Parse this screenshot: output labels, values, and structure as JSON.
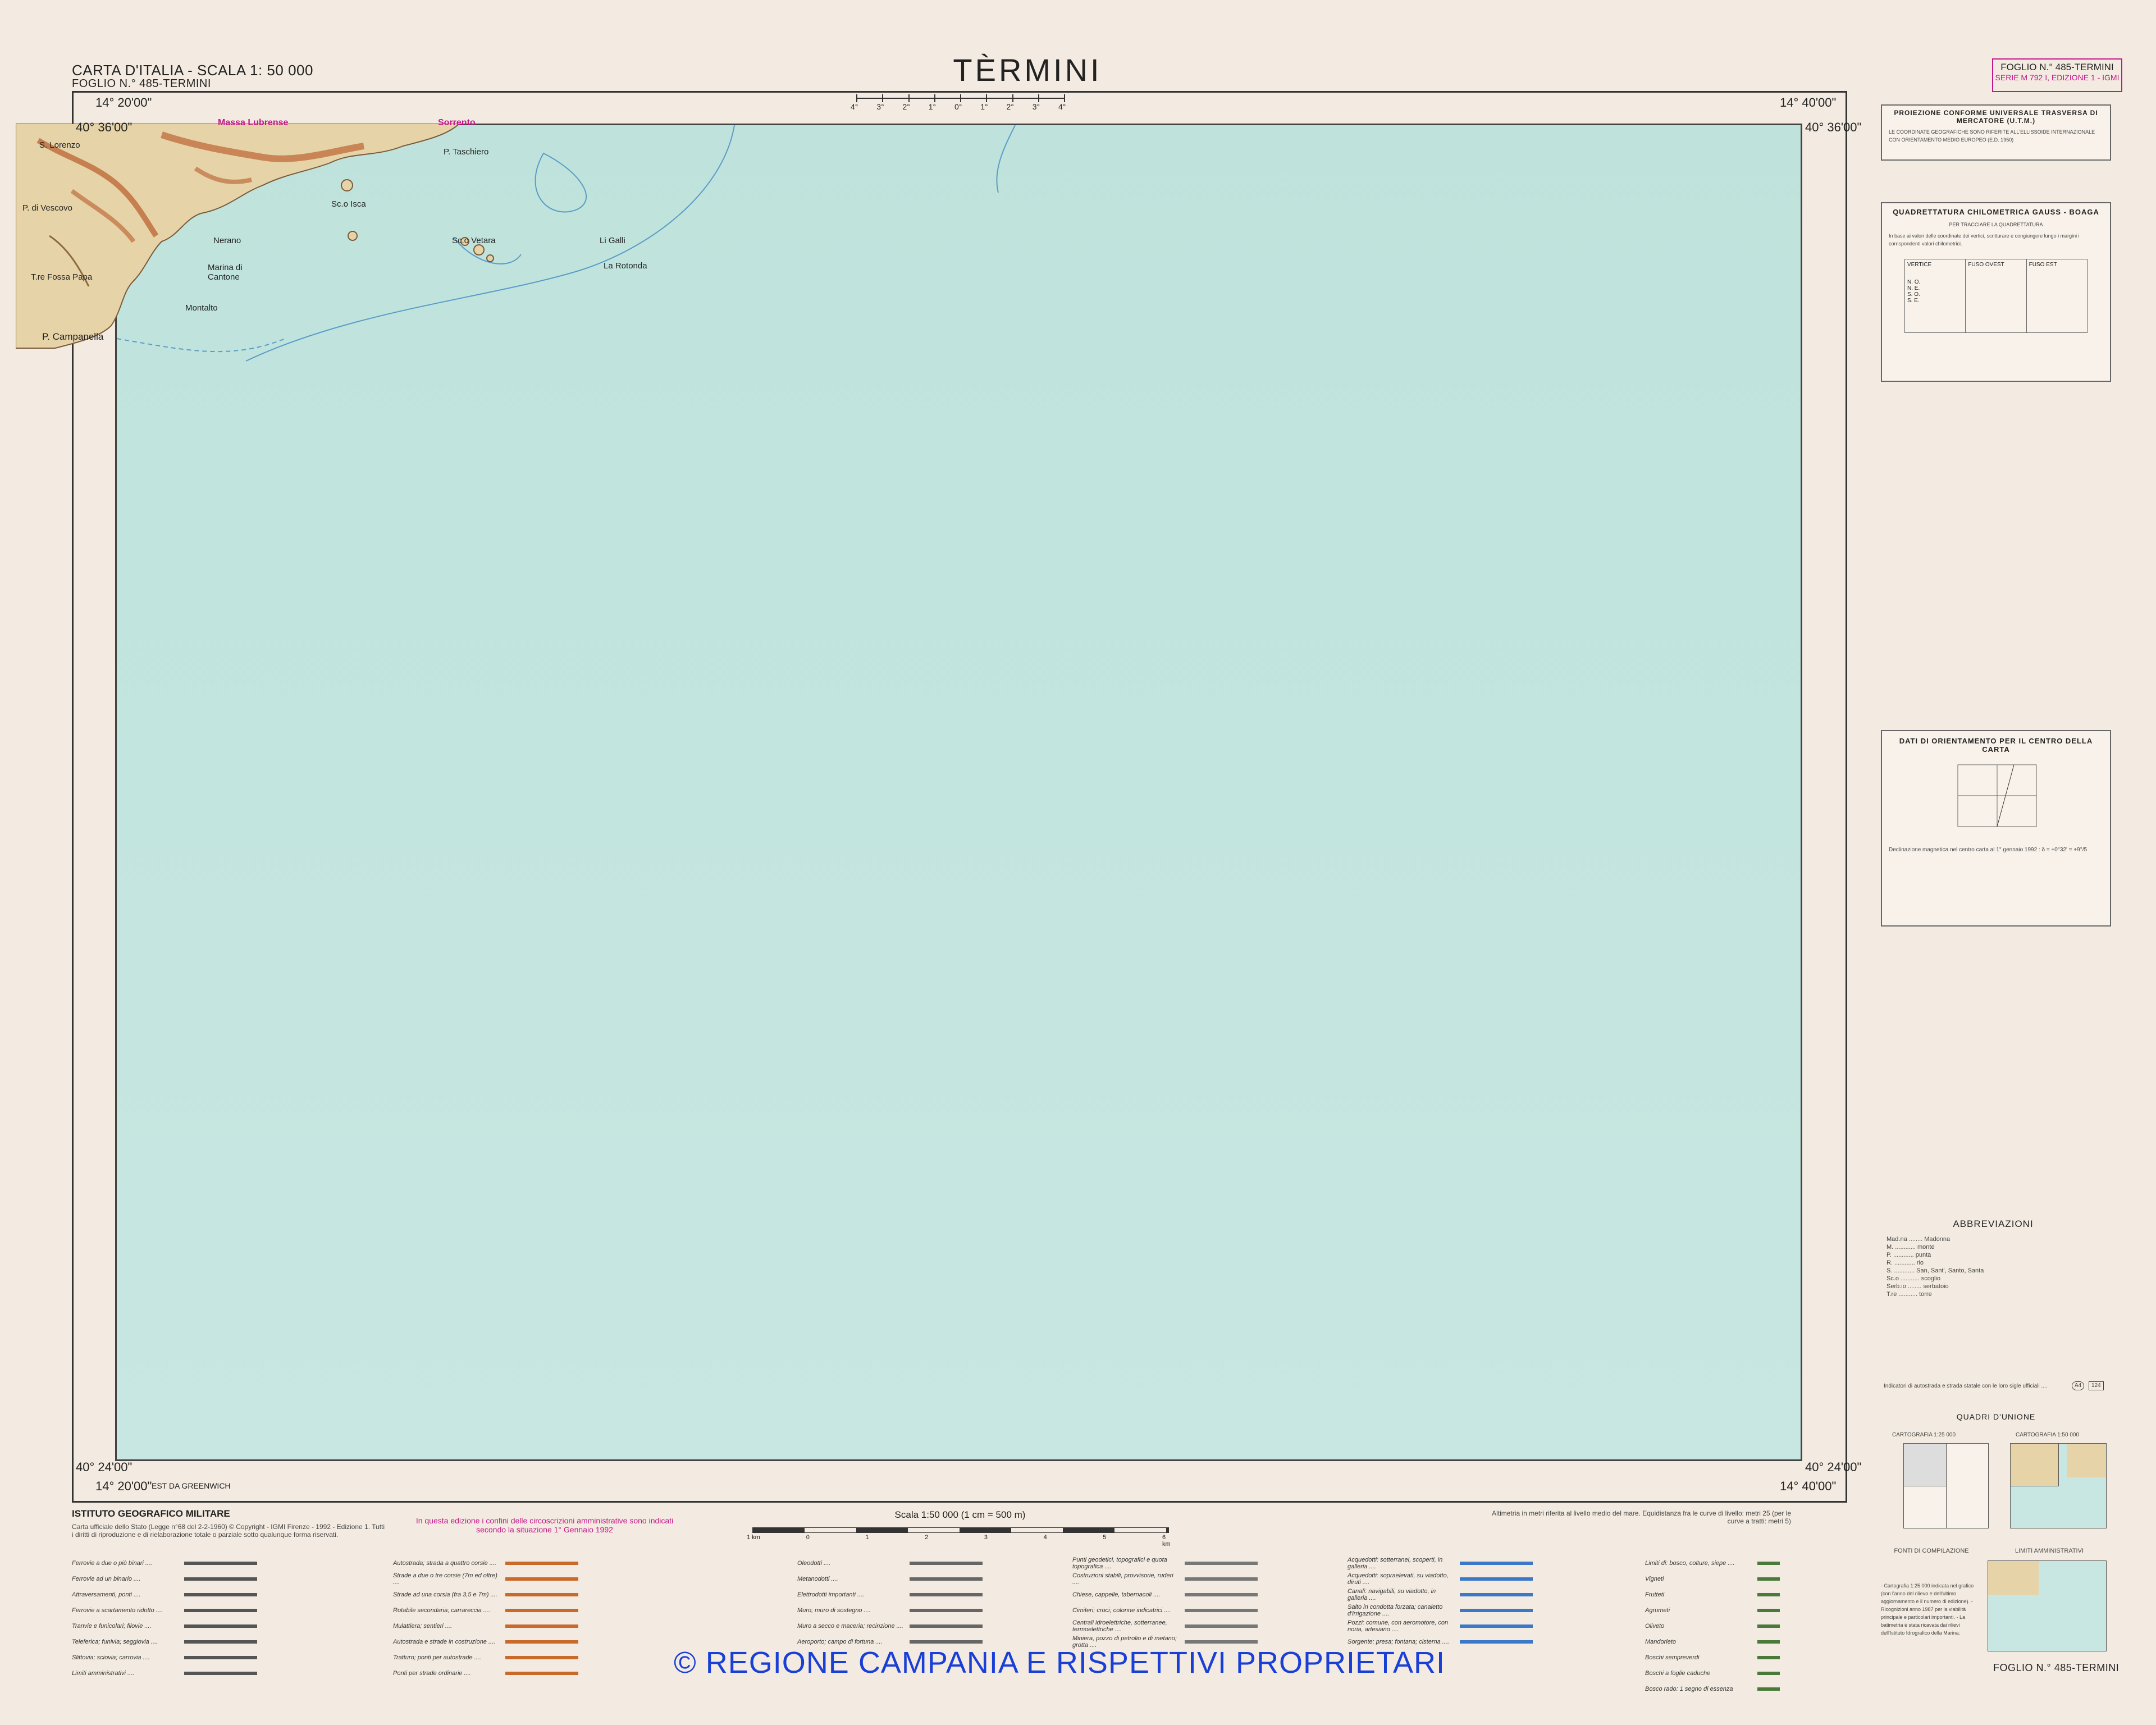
{
  "header": {
    "series_title": "CARTA D'ITALIA - SCALA 1: 50 000",
    "sheet_line": "FOGLIO N.° 485-TERMINI",
    "title": "TÈRMINI",
    "sheet_box_line1": "FOGLIO N.° 485-TERMINI",
    "sheet_box_line2": "SERIE M 792 I, EDIZIONE 1 - IGMI"
  },
  "declination_ticks": [
    "4°",
    "3°",
    "2°",
    "1°",
    "0°",
    "1°",
    "2°",
    "3°",
    "4°"
  ],
  "coords": {
    "top_left_lon": "14° 20'00\"",
    "top_right_lon": "14° 40'00\"",
    "top_left_lat": "40° 36'00\"",
    "top_right_lat": "40° 36'00\"",
    "bottom_left_lat": "40° 24'00\"",
    "bottom_right_lat": "40° 24'00\"",
    "bottom_left_lon": "14° 20'00\"",
    "bottom_left_note": "EST DA GREENWICH",
    "bottom_right_lon": "14° 40'00\""
  },
  "places": {
    "massa": "Massa Lubrense",
    "sorrento": "Sorrento",
    "s_lorenzo": "S. Lorenzo",
    "marina": "Marina di Cantone",
    "campanella": "P. Campanella",
    "montalto": "Montalto",
    "vescovo": "P. di Vescovo",
    "galli": "Li Galli",
    "vetara": "Sc.o Vetara",
    "isca": "Sc.o Isca",
    "ischia_punta": "P. Taschiero",
    "rotonda": "La Rotonda",
    "fossa_papa": "T.re Fossa Papa",
    "nerano": "Nerano"
  },
  "right_panels": {
    "proj_title": "PROIEZIONE CONFORME UNIVERSALE TRASVERSA DI MERCATORE (U.T.M.)",
    "proj_text": "LE COORDINATE GEOGRAFICHE SONO RIFERITE ALL'ELLISSOIDE INTERNAZIONALE CON ORIENTAMENTO MEDIO EUROPEO (E.D. 1950)",
    "gauss_title": "QUADRETTATURA CHILOMETRICA GAUSS - BOAGA",
    "gauss_sub": "PER TRACCIARE LA QUADRETTATURA",
    "gauss_text": "In base ai valori delle coordinate dei vertici, scritturare e congiungere lungo i margini i corrispondenti valori chilometrici.",
    "gauss_cols": [
      "VERTICE",
      "FUSO OVEST",
      "FUSO EST"
    ],
    "gauss_rows": [
      "N. O.",
      "N. E.",
      "S. O.",
      "S. E."
    ],
    "orient_title": "DATI DI ORIENTAMENTO PER IL CENTRO DELLA CARTA",
    "orient_text": "Declinazione magnetica nel centro carta al 1° gennaio 1992 : δ = +0°32' = +9°/5",
    "abbrev_title": "ABBREVIAZIONI",
    "abbrev": [
      "Mad.na ........ Madonna",
      "M. ............ monte",
      "P. ............ punta",
      "R. ............ rio",
      "S. ............ San, Sant', Santo, Santa",
      "Sc.o ........... scoglio",
      "Serb.io ........ serbatoio",
      "T.re ........... torre"
    ],
    "indicator_text": "Indicatori di autostrada e strada statale con le loro sigle ufficiali ....",
    "indicator_a": "A4",
    "indicator_s": "124",
    "quadri_title": "QUADRI D'UNIONE",
    "quadri_left": "CARTOGRAFIA 1:25 000",
    "quadri_right": "CARTOGRAFIA 1:50 000",
    "fonti_title": "FONTI DI COMPILAZIONE",
    "fonti_text": "- Cartografia 1:25 000 indicata nel grafico (con l'anno del rilievo e dell'ultimo aggiornamento e il numero di edizione). - Ricognizioni anno 1987 per la viabilità principale e particolari importanti. - La batimetria è stata ricavata dai rilievi dell'Istituto Idrografico della Marina.",
    "limiti_title": "LIMITI AMMINISTRATIVI",
    "footer_sheet": "FOGLIO N.° 485-TERMINI"
  },
  "bottom": {
    "igm": "ISTITUTO GEOGRAFICO MILITARE",
    "igm_text": "Carta ufficiale dello Stato (Legge n°68 del 2-2-1960) © Copyright - IGMI Firenze - 1992 - Edizione 1. Tutti i diritti di riproduzione e di rielaborazione totale o parziale sotto qualunque forma riservati.",
    "edition_note": "In questa edizione i confini delle circoscrizioni amministrative sono indicati secondo la situazione 1° Gennaio 1992",
    "scale_label": "Scala 1:50 000 (1 cm = 500 m)",
    "scale_ticks": [
      "1 km",
      "0",
      "1",
      "2",
      "3",
      "4",
      "5",
      "6 km"
    ],
    "altimetry": "Altimetria in metri riferita al livello medio del mare. Equidistanza fra le curve di livello: metri 25 (per le curve a tratti: metri 5)",
    "watermark": "© REGIONE CAMPANIA E RISPETTIVI PROPRIETARI"
  },
  "legend": {
    "col1": [
      "Ferrovie a due o più binari ....",
      "Ferrovie ad un binario ....",
      "Attraversamenti, ponti ....",
      "Ferrovie a scartamento ridotto ....",
      "Tranvie e funicolari; filovie ....",
      "Teleferica; funivia; seggiovia ....",
      "Slittovia; sciovia; carrovia ....",
      "Limiti amministrativi ...."
    ],
    "col2": [
      "Autostrada; strada a quattro corsie ....",
      "Strade a due o tre corsie (7m ed oltre) ....",
      "Strade ad una corsia (fra 3,5 e 7m) ....",
      "Rotabile secondaria; carrareccia ....",
      "Mulattiera; sentieri ....",
      "Autostrada e strade in costruzione ....",
      "Tratturo; ponti per autostrade ....",
      "Ponti per strade ordinarie ...."
    ],
    "col3": [
      "Oleodotti ....",
      "Metanodotti ....",
      "Elettrodotti importanti ....",
      "Muro; muro di sostegno ....",
      "Muro a secco e maceria; recinzione ....",
      "Aeroporto; campo di fortuna ...."
    ],
    "col4": [
      "Punti geodetici, topografici e quota topografica ....",
      "Costruzioni stabili, provvisorie, ruderi ....",
      "Chiese, cappelle, tabernacoli ....",
      "Cimiteri; croci; colonne indicatrici ....",
      "Centrali idroelettriche, sotterranee, termoelettriche ....",
      "Miniera, pozzo di petrolio e di metano; grotta ...."
    ],
    "col5": [
      "Acquedotti: sotterranei, scoperti, in galleria ....",
      "Acquedotti: sopraelevati, su viadotto, diruti ....",
      "Canali: navigabili, su viadotto, in galleria ....",
      "Salto in condotta forzata; canaletto d'irrigazione ....",
      "Pozzi: comune, con aeromotore, con noria, artesiano ....",
      "Sorgente; presa; fontana; cisterna ...."
    ],
    "col6": [
      "Limiti di: bosco, colture, siepe ....",
      "Vigneti",
      "Frutteti",
      "Agrumeti",
      "Oliveto",
      "Mandorleto",
      "Boschi sempreverdi",
      "Boschi a foglie caduche",
      "Bosco rado: 1 segno di essenza"
    ]
  },
  "colors": {
    "sea": "#c2e4de",
    "paper": "#f3ebe1",
    "accent": "#c2188b",
    "watermark": "#1a3fd6",
    "land": "#e6d3a8",
    "relief": "#b5521f"
  }
}
